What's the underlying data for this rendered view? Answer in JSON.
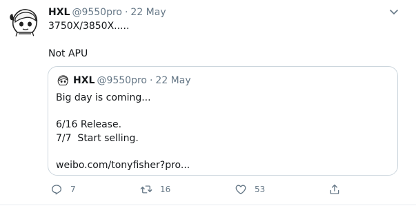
{
  "tweet": {
    "author_name": "HXL",
    "author_handle": "@9550pro",
    "separator": "·",
    "date": "22 May",
    "text_lines": [
      "3750X/3850X.....",
      "",
      "Not APU"
    ],
    "icons": {
      "avatar": "avatar-anime-girl",
      "menu": "chevron-down-icon"
    }
  },
  "quote": {
    "author_name": "HXL",
    "author_handle": "@9550pro",
    "separator": "·",
    "date": "22 May",
    "text_lines": [
      "Big day is coming...",
      "",
      "6/16 Release.",
      "7/7  Start selling.",
      "",
      "weibo.com/tonyfisher?pro..."
    ]
  },
  "actions": {
    "reply": {
      "icon": "reply-icon",
      "count": "7"
    },
    "retweet": {
      "icon": "retweet-icon",
      "count": "16"
    },
    "like": {
      "icon": "heart-icon",
      "count": "53"
    },
    "share": {
      "icon": "share-icon"
    }
  },
  "colors": {
    "text": "#14171a",
    "secondary": "#657786",
    "border": "#ccd6dd"
  }
}
